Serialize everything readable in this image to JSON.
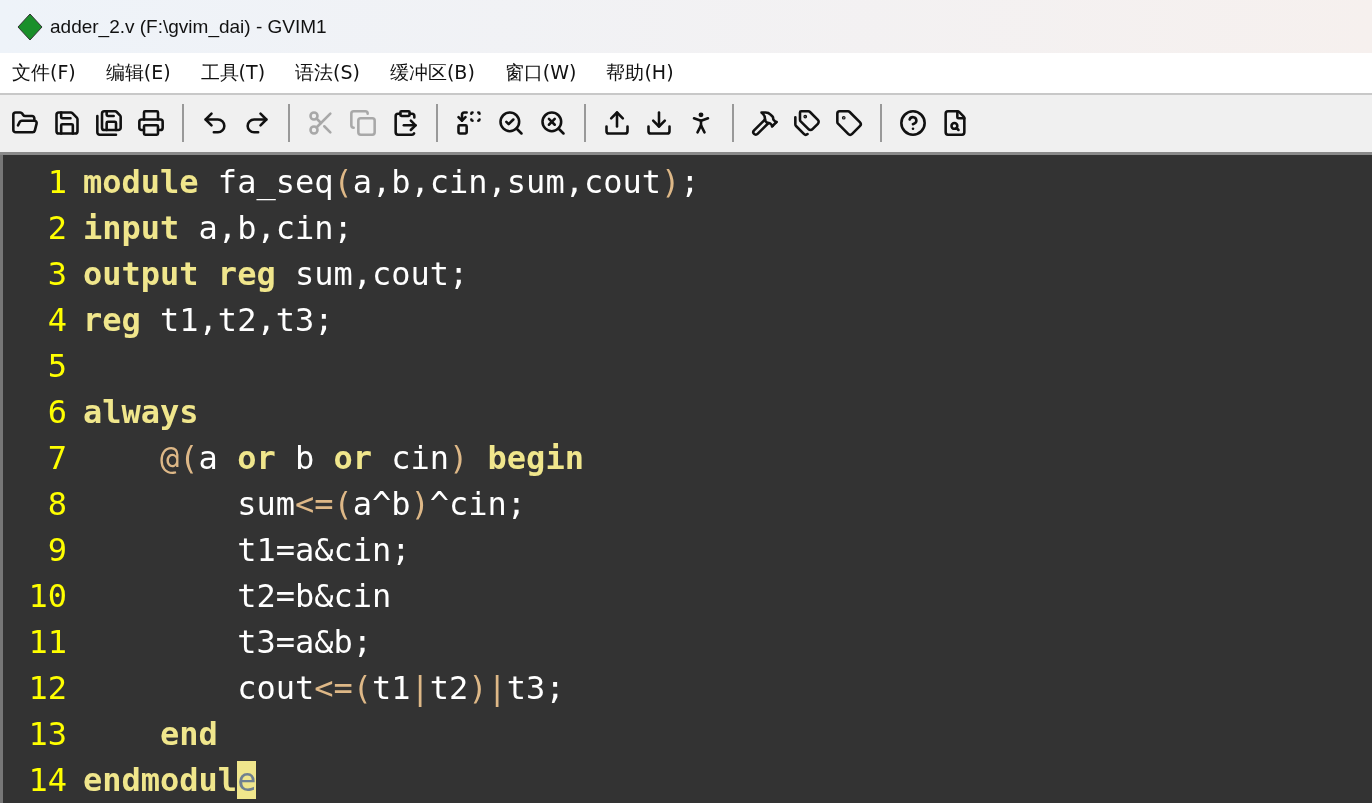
{
  "window": {
    "title": "adder_2.v (F:\\gvim_dai) - GVIM1"
  },
  "menu": [
    "文件(F)",
    "编辑(E)",
    "工具(T)",
    "语法(S)",
    "缓冲区(B)",
    "窗口(W)",
    "帮助(H)"
  ],
  "toolbar": [
    [
      {
        "disabled": false
      },
      {
        "disabled": false
      },
      {
        "disabled": false
      },
      {
        "disabled": false
      }
    ],
    [
      {
        "disabled": false
      },
      {
        "disabled": false
      }
    ],
    [
      {
        "disabled": true
      },
      {
        "disabled": true
      },
      {
        "disabled": false
      }
    ],
    [
      {
        "disabled": false
      },
      {
        "disabled": false
      },
      {
        "disabled": false
      }
    ],
    [
      {
        "disabled": false
      },
      {
        "disabled": false
      },
      {
        "disabled": false
      }
    ],
    [
      {
        "disabled": false
      },
      {
        "disabled": false
      },
      {
        "disabled": false
      }
    ],
    [
      {
        "disabled": false
      },
      {
        "disabled": false
      }
    ]
  ],
  "editor": {
    "lines": [
      {
        "number": "1",
        "tokens": [
          {
            "kind": "keyword",
            "text": "module"
          },
          {
            "kind": "ident",
            "text": " fa_seq"
          },
          {
            "kind": "op",
            "text": "("
          },
          {
            "kind": "ident",
            "text": "a,b,cin,sum,cout"
          },
          {
            "kind": "op",
            "text": ")"
          },
          {
            "kind": "ident",
            "text": ";"
          }
        ]
      },
      {
        "number": "2",
        "tokens": [
          {
            "kind": "keyword",
            "text": "input"
          },
          {
            "kind": "ident",
            "text": " a,b,cin;"
          }
        ]
      },
      {
        "number": "3",
        "tokens": [
          {
            "kind": "keyword",
            "text": "output reg"
          },
          {
            "kind": "ident",
            "text": " sum,cout;"
          }
        ]
      },
      {
        "number": "4",
        "tokens": [
          {
            "kind": "keyword",
            "text": "reg"
          },
          {
            "kind": "ident",
            "text": " t1,t2,t3;"
          }
        ]
      },
      {
        "number": "5"
      },
      {
        "number": "6",
        "tokens": [
          {
            "kind": "keyword",
            "text": "always"
          }
        ]
      },
      {
        "number": "7",
        "tokens": [
          {
            "kind": "op",
            "text": "    @("
          },
          {
            "kind": "ident",
            "text": "a "
          },
          {
            "kind": "keyword",
            "text": "or"
          },
          {
            "kind": "ident",
            "text": " b "
          },
          {
            "kind": "keyword",
            "text": "or"
          },
          {
            "kind": "ident",
            "text": " cin"
          },
          {
            "kind": "op",
            "text": ")"
          },
          {
            "kind": "keyword",
            "text": " begin"
          }
        ]
      },
      {
        "number": "8",
        "tokens": [
          {
            "kind": "ident",
            "text": "        sum"
          },
          {
            "kind": "op",
            "text": "<=("
          },
          {
            "kind": "ident",
            "text": "a^b"
          },
          {
            "kind": "op",
            "text": ")"
          },
          {
            "kind": "ident",
            "text": "^cin;"
          }
        ]
      },
      {
        "number": "9",
        "tokens": [
          {
            "kind": "ident",
            "text": "        t1=a&cin;"
          }
        ]
      },
      {
        "number": "10",
        "tokens": [
          {
            "kind": "ident",
            "text": "        t2=b&cin"
          }
        ]
      },
      {
        "number": "11",
        "tokens": [
          {
            "kind": "ident",
            "text": "        t3=a&b;"
          }
        ]
      },
      {
        "number": "12",
        "tokens": [
          {
            "kind": "ident",
            "text": "        cout"
          },
          {
            "kind": "op",
            "text": "<=("
          },
          {
            "kind": "ident",
            "text": "t1"
          },
          {
            "kind": "op",
            "text": "|"
          },
          {
            "kind": "ident",
            "text": "t2"
          },
          {
            "kind": "op",
            "text": ")|"
          },
          {
            "kind": "ident",
            "text": "t3;"
          }
        ]
      },
      {
        "number": "13",
        "tokens": [
          {
            "kind": "keyword",
            "text": "    end"
          }
        ]
      },
      {
        "number": "14",
        "tokens": [
          {
            "kind": "keyword",
            "text": "endmodul"
          },
          {
            "kind": "cursor",
            "text": "e"
          }
        ]
      }
    ]
  }
}
